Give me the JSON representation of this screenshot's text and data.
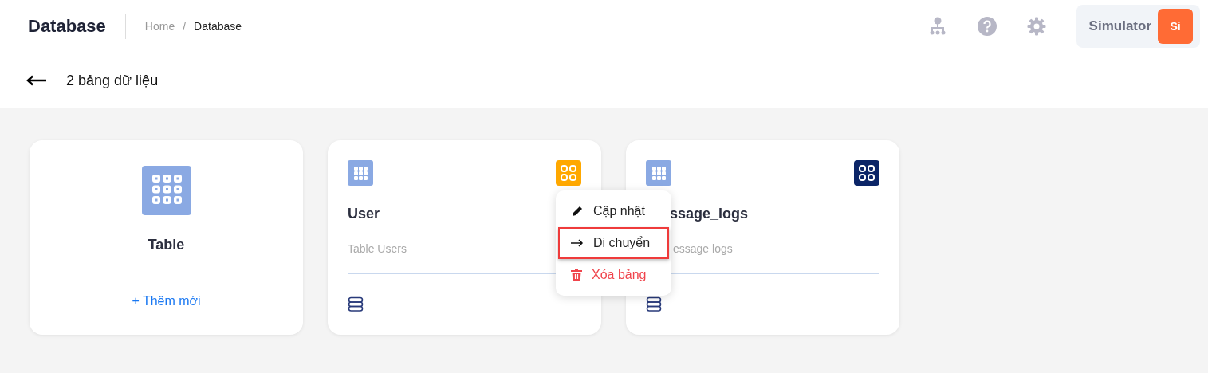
{
  "header": {
    "title": "Database",
    "breadcrumb": [
      {
        "label": "Home",
        "current": false
      },
      {
        "label": "Database",
        "current": true
      }
    ],
    "breadcrumb_separator": "/",
    "user": {
      "name": "Simulator",
      "initials": "Si"
    }
  },
  "subheader": {
    "title": "2 bảng dữ liệu"
  },
  "cards": [
    {
      "kind": "add",
      "title": "Table",
      "action": "+ Thêm mới"
    },
    {
      "kind": "table",
      "title": "User",
      "description": "Table Users",
      "color": "#ffa800",
      "menu": [
        {
          "kind": "edit",
          "label": "Cập nhật",
          "selected": false
        },
        {
          "kind": "move",
          "label": "Di chuyển",
          "selected": true
        },
        {
          "kind": "delete",
          "label": "Xóa bảng",
          "selected": false
        }
      ]
    },
    {
      "kind": "table",
      "title": "ssage_logs",
      "description": "essage logs",
      "color": "#0b2567"
    }
  ]
}
